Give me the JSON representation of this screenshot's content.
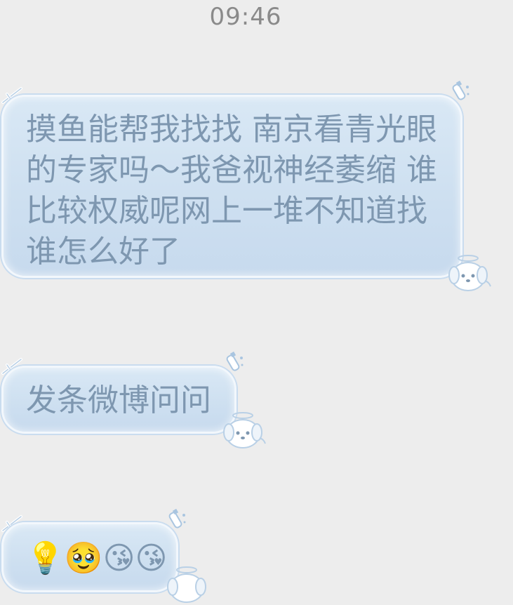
{
  "status": {
    "time": "09:46"
  },
  "messages": [
    {
      "text": "摸鱼能帮我找找 南京看青光眼的专家吗～我爸视神经萎缩 谁比较权威呢网上一堆不知道找谁怎么好了"
    },
    {
      "text": "发条微博问问"
    },
    {
      "emojis": [
        {
          "name": "lightbulb-person-icon",
          "glyph": "💡"
        },
        {
          "name": "crying-grateful-face-icon",
          "glyph": "🥹"
        },
        {
          "name": "kissing-heart-face-icon",
          "glyph": "😘"
        },
        {
          "name": "kissing-heart-face-icon",
          "glyph": "😘"
        }
      ]
    }
  ],
  "colors": {
    "background": "#ededed",
    "bubble_fill": "#cddff0",
    "bubble_border": "#f2f7fc",
    "bubble_text": "#7e97b0",
    "timestamp": "#8a8a8a"
  }
}
